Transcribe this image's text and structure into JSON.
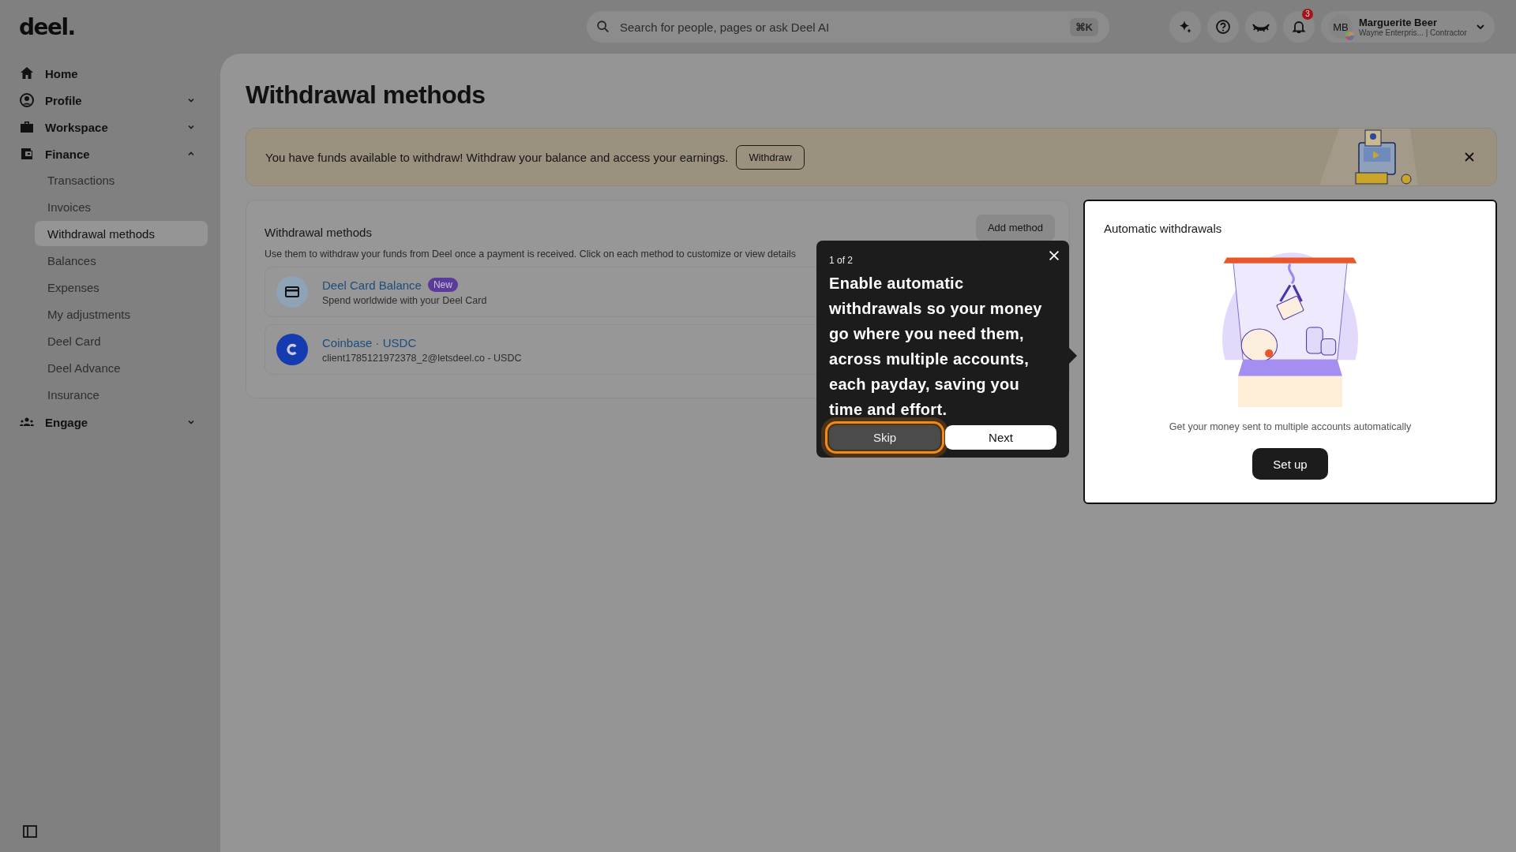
{
  "top_bar": {
    "logo": "deel.",
    "search": {
      "placeholder": "Search for people, pages or ask Deel AI",
      "shortcut": "⌘K"
    },
    "notifications": "3",
    "user": {
      "initials": "MB",
      "name": "Marguerite Beer",
      "subtitle": "Wayne Enterpris... | Contractor"
    }
  },
  "sidebar": {
    "items": [
      {
        "label": "Home"
      },
      {
        "label": "Profile",
        "expanded": false
      },
      {
        "label": "Workspace",
        "expanded": false
      },
      {
        "label": "Finance",
        "expanded": true,
        "children": [
          {
            "label": "Transactions",
            "selected": false
          },
          {
            "label": "Invoices",
            "selected": false
          },
          {
            "label": "Withdrawal methods",
            "selected": true
          },
          {
            "label": "Balances",
            "selected": false
          },
          {
            "label": "Expenses",
            "selected": false
          },
          {
            "label": "My adjustments",
            "selected": false
          },
          {
            "label": "Deel Card",
            "selected": false
          },
          {
            "label": "Deel Advance",
            "selected": false
          },
          {
            "label": "Insurance",
            "selected": false
          }
        ]
      },
      {
        "label": "Engage",
        "expanded": false
      }
    ]
  },
  "page": {
    "title": "Withdrawal methods",
    "banner": {
      "text": "You have funds available to withdraw! Withdraw your balance and access your earnings.",
      "button": "Withdraw"
    },
    "methods_card": {
      "title": "Withdrawal methods",
      "button": "Add method",
      "description": "Use them to withdraw your funds from Deel once a payment is received. Click on each method to customize or view details",
      "methods": [
        {
          "kind": "card",
          "name": "Deel Card Balance",
          "badge": "New",
          "detail": "Spend worldwide with your Deel Card"
        },
        {
          "kind": "coin",
          "name": "Coinbase · USDC",
          "detail": "client1785121972378_2@letsdeel.co - USDC"
        }
      ]
    },
    "auto_card": {
      "title": "Automatic withdrawals",
      "caption": "Get your money sent to multiple accounts automatically",
      "button": "Set up"
    }
  },
  "tour": {
    "step": "1 of 2",
    "text": "Enable automatic withdrawals so your money go where you need them, across multiple accounts, each payday, saving you time and effort.",
    "buttons": [
      {
        "label": "Skip",
        "kind": "secondary",
        "focused": true
      },
      {
        "label": "Next",
        "kind": "primary",
        "focused": false
      }
    ]
  }
}
